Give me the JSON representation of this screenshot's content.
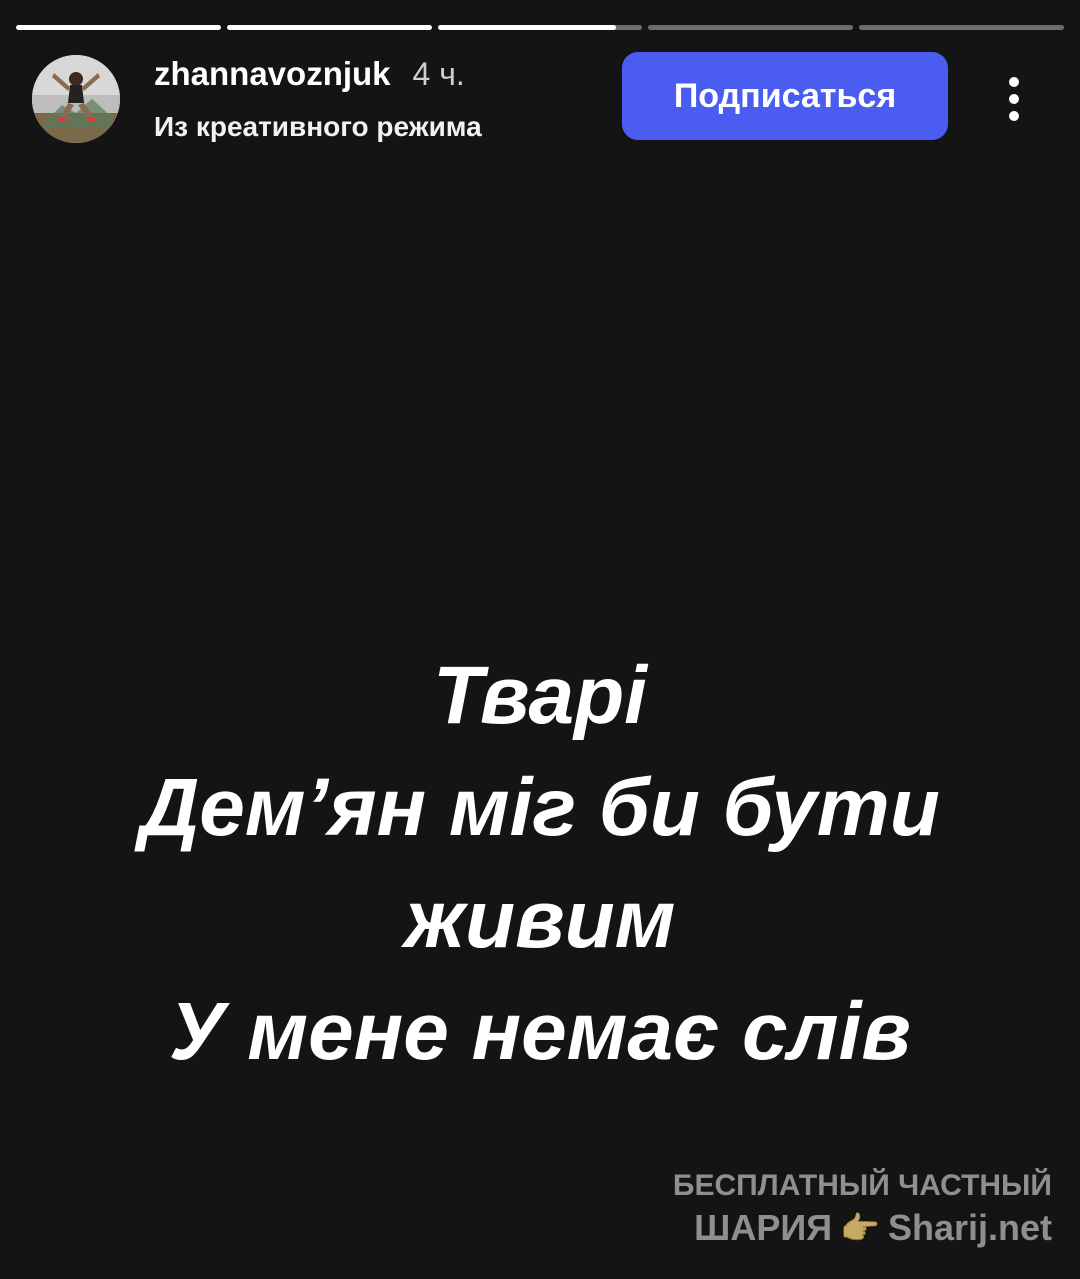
{
  "progress": {
    "segments": [
      1,
      1,
      0.87,
      0,
      0
    ]
  },
  "header": {
    "avatar_icon": "athlete-avatar",
    "username": "zhannavoznjuk",
    "time": "4 ч.",
    "subtitle": "Из креативного режима",
    "subscribe_label": "Подписаться",
    "more_icon": "more-vertical-icon"
  },
  "story": {
    "lines": [
      "Тварі",
      "Дем’ян міг би бути",
      "живим",
      "У мене немає слів"
    ]
  },
  "watermark": {
    "line1": "БЕСПЛАТНЫЙ ЧАСТНЫЙ",
    "line2_left": "ШАРИЯ",
    "line2_right": "Sharij.net",
    "hand_icon": "pointing-hand-icon"
  },
  "colors": {
    "background": "#141414",
    "accent": "#4b5cf0"
  }
}
